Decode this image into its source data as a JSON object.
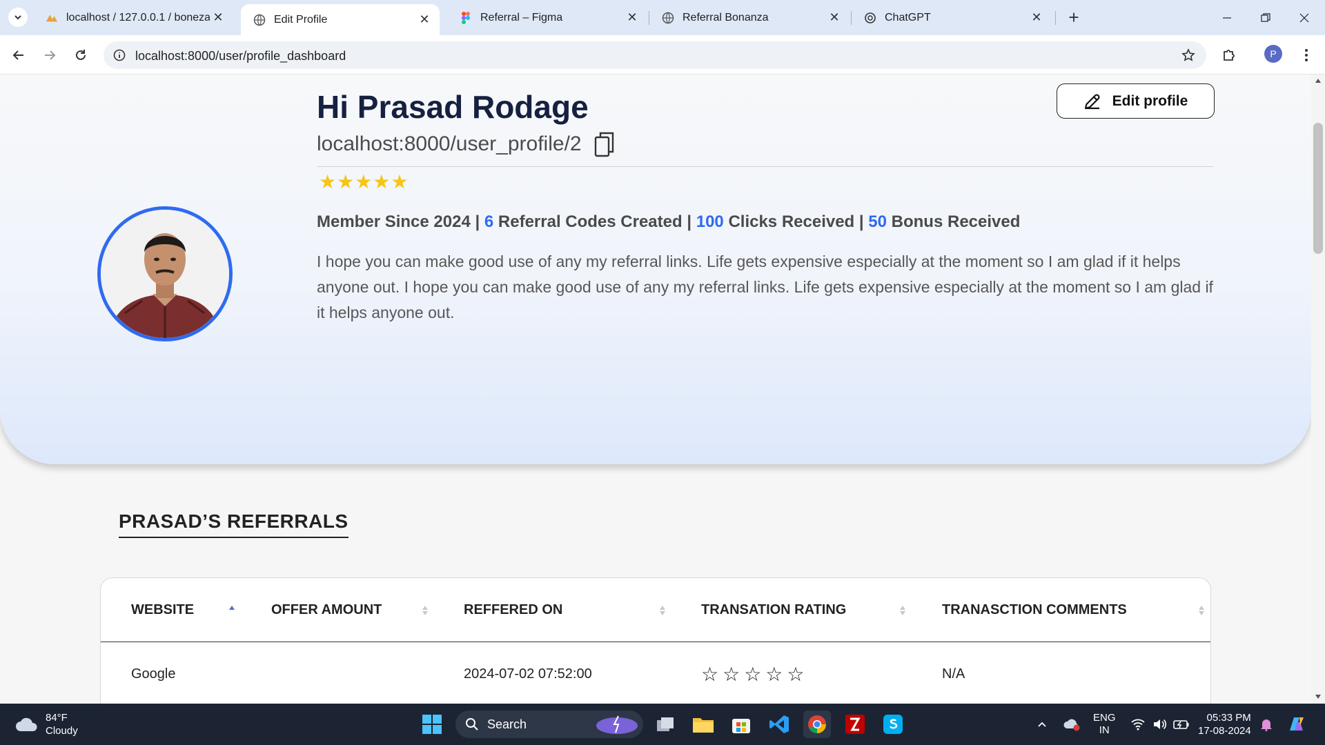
{
  "browser": {
    "tabs": [
      {
        "title": "localhost / 127.0.0.1 / boneza_l",
        "icon": "phpmyadmin-icon"
      },
      {
        "title": "Edit Profile",
        "icon": "globe-icon"
      },
      {
        "title": "Referral – Figma",
        "icon": "figma-icon"
      },
      {
        "title": "Referral Bonanza",
        "icon": "globe-icon"
      },
      {
        "title": "ChatGPT",
        "icon": "chatgpt-icon"
      }
    ],
    "url": "localhost:8000/user/profile_dashboard",
    "profile_initial": "P"
  },
  "profile": {
    "greeting": "Hi Prasad Rodage",
    "profile_link": "localhost:8000/user_profile/2",
    "rating_stars": "★★★★★",
    "rating": 5,
    "stats": {
      "member_since": "Member Since 2024",
      "sep": "|",
      "codes_num": "6",
      "codes_label": "Referral Codes Created",
      "clicks_num": "100",
      "clicks_label": "Clicks Received",
      "bonus_num": "50",
      "bonus_label": "Bonus Received"
    },
    "bio": "I hope you can make good use of any my referral links. Life gets expensive especially at the moment so I am glad if it helps anyone out. I hope you can make good use of any my referral links. Life gets expensive especially at the moment so I am glad if it helps anyone out.",
    "edit_label": "Edit profile"
  },
  "referrals": {
    "title": "PRASAD’S REFERRALS",
    "columns": [
      "WEBSITE",
      "OFFER AMOUNT",
      "REFFERED ON",
      "TRANSATION RATING",
      "TRANASCTION COMMENTS"
    ],
    "rows": [
      {
        "website": "Google",
        "offer_amount": "",
        "referred_on": "2024-07-02 07:52:00",
        "rating_stars": "☆☆☆☆☆",
        "rating": 0,
        "comments": "N/A"
      }
    ]
  },
  "taskbar": {
    "weather_temp": "84°F",
    "weather_desc": "Cloudy",
    "search_label": "Search",
    "lang": "ENG",
    "region": "IN",
    "time": "05:33 PM",
    "date": "17-08-2024"
  },
  "colors": {
    "accent": "#2f6bf0",
    "star": "#f5c518",
    "heading": "#162040"
  }
}
